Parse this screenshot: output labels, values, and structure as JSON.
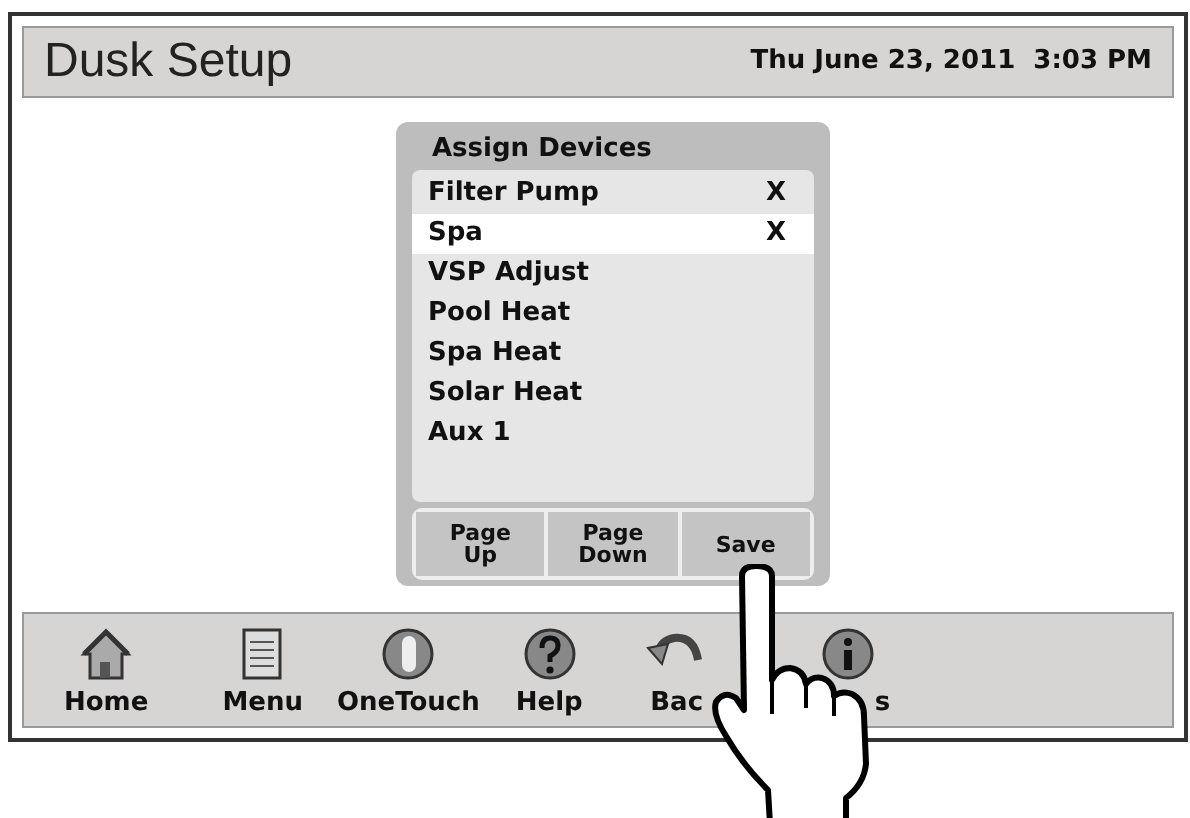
{
  "header": {
    "title": "Dusk Setup",
    "datetime": "Thu June 23, 2011  3:03 PM"
  },
  "dialog": {
    "title": "Assign Devices",
    "items": [
      {
        "label": "Filter Pump",
        "marker": "X",
        "selected": false
      },
      {
        "label": "Spa",
        "marker": "X",
        "selected": true
      },
      {
        "label": "VSP Adjust",
        "selected": false
      },
      {
        "label": "Pool Heat",
        "selected": false
      },
      {
        "label": "Spa Heat",
        "selected": false
      },
      {
        "label": "Solar Heat",
        "selected": false
      },
      {
        "label": "Aux 1",
        "selected": false
      }
    ],
    "buttons": [
      "Page\nUp",
      "Page\nDown",
      "Save"
    ]
  },
  "toolbar": [
    {
      "kind": "home",
      "label": "Home"
    },
    {
      "kind": "menu",
      "label": "Menu"
    },
    {
      "kind": "onetouch",
      "label": "OneTouch"
    },
    {
      "kind": "help",
      "label": "Help"
    },
    {
      "kind": "back",
      "label": "Bac"
    },
    {
      "kind": "info",
      "label": "s"
    }
  ]
}
